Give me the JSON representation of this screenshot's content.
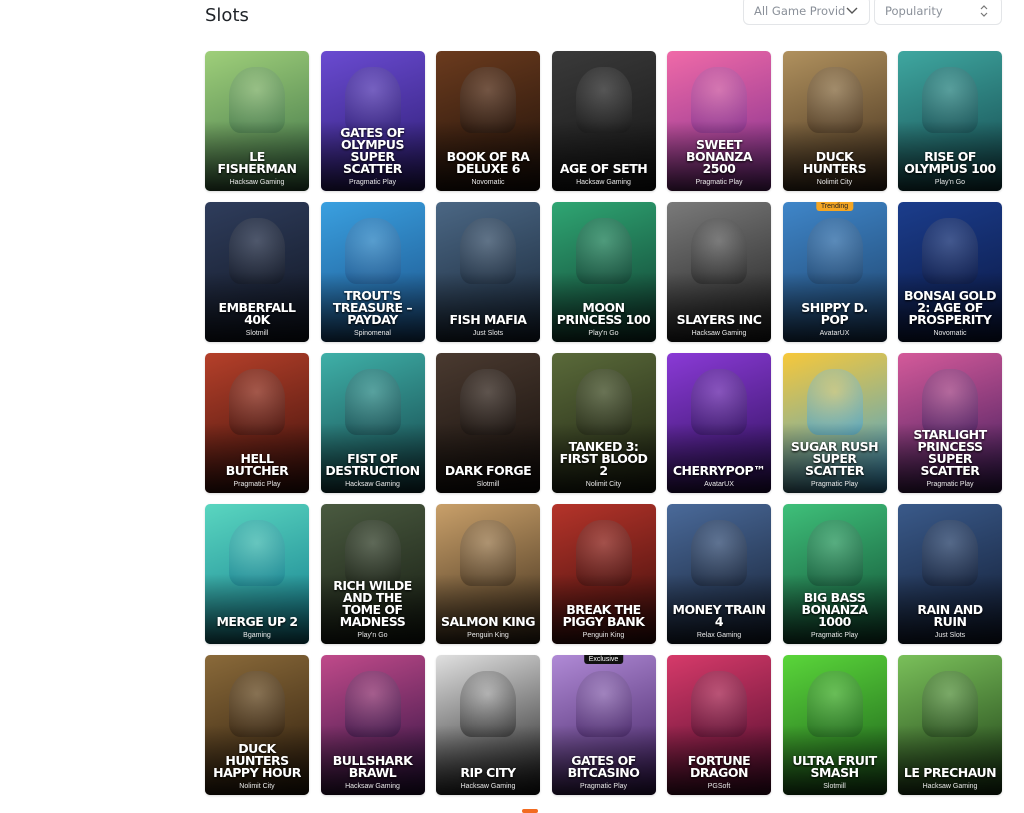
{
  "page": {
    "title": "Slots"
  },
  "filters": {
    "provider": {
      "value": "All Game Provid...",
      "icon": "chevron-down-icon"
    },
    "sort": {
      "value": "Popularity",
      "icon": "sort-updown-icon"
    }
  },
  "games": [
    {
      "title": "LE FISHERMAN",
      "provider": "Hacksaw Gaming",
      "c1": "#9fcf7a",
      "c2": "#3b6f45"
    },
    {
      "title": "GATES OF OLYMPUS SUPER SCATTER",
      "provider": "Pragmatic Play",
      "c1": "#6a4bd1",
      "c2": "#2a1a6e"
    },
    {
      "title": "BOOK OF RA DELUXE 6",
      "provider": "Novomatic",
      "c1": "#6b3b1e",
      "c2": "#1c0f08"
    },
    {
      "title": "AGE OF SETH",
      "provider": "Hacksaw Gaming",
      "c1": "#3a3a3a",
      "c2": "#141414"
    },
    {
      "title": "SWEET BONANZA 2500",
      "provider": "Pragmatic Play",
      "c1": "#f06aa8",
      "c2": "#7b2c8c"
    },
    {
      "title": "DUCK HUNTERS",
      "provider": "Nolimit City",
      "c1": "#b0915e",
      "c2": "#3f2c1a"
    },
    {
      "title": "RISE OF OLYMPUS 100",
      "provider": "Play'n Go",
      "c1": "#3fa7a0",
      "c2": "#12444a"
    },
    {
      "title": "EMBERFALL 40K",
      "provider": "Slotmill",
      "c1": "#2f3d5c",
      "c2": "#0f1420"
    },
    {
      "title": "TROUT'S TREASURE – PAYDAY",
      "provider": "Spinomenal",
      "c1": "#3aa0e0",
      "c2": "#1a4f86"
    },
    {
      "title": "FISH MAFIA",
      "provider": "Just Slots",
      "c1": "#4b6784",
      "c2": "#172536"
    },
    {
      "title": "MOON PRINCESS 100",
      "provider": "Play'n Go",
      "c1": "#2fa673",
      "c2": "#0f3a2e"
    },
    {
      "title": "SLAYERS INC",
      "provider": "Hacksaw Gaming",
      "c1": "#7a7a7a",
      "c2": "#1e1e1e"
    },
    {
      "title": "SHIPPY D. POP",
      "provider": "AvatarUX",
      "c1": "#3f86c9",
      "c2": "#1c3f66",
      "badge": "Trending",
      "badgeType": "trending"
    },
    {
      "title": "BONSAI GOLD 2: AGE OF PROSPERITY",
      "provider": "Novomatic",
      "c1": "#1b3d8c",
      "c2": "#0a1640"
    },
    {
      "title": "HELL BUTCHER",
      "provider": "Pragmatic Play",
      "c1": "#b5402a",
      "c2": "#3a0f0a"
    },
    {
      "title": "FIST OF DESTRUCTION",
      "provider": "Hacksaw Gaming",
      "c1": "#3fb0a8",
      "c2": "#123f45"
    },
    {
      "title": "DARK FORGE",
      "provider": "Slotmill",
      "c1": "#4a3a30",
      "c2": "#120c09"
    },
    {
      "title": "TANKED 3: FIRST BLOOD 2",
      "provider": "Nolimit City",
      "c1": "#5a6a3a",
      "c2": "#1c2010"
    },
    {
      "title": "CHERRYPOP™",
      "provider": "AvatarUX",
      "c1": "#8a3ad6",
      "c2": "#2a0f55"
    },
    {
      "title": "SUGAR RUSH SUPER SCATTER",
      "provider": "Pragmatic Play",
      "c1": "#f7c83a",
      "c2": "#3aa0d8"
    },
    {
      "title": "STARLIGHT PRINCESS SUPER SCATTER",
      "provider": "Pragmatic Play",
      "c1": "#d45a9a",
      "c2": "#3a1a5a"
    },
    {
      "title": "MERGE UP 2",
      "provider": "Bgaming",
      "c1": "#5ad6c0",
      "c2": "#117a8c"
    },
    {
      "title": "RICH WILDE AND THE TOME OF MADNESS",
      "provider": "Play'n Go",
      "c1": "#4a5a40",
      "c2": "#141a10"
    },
    {
      "title": "SALMON KING",
      "provider": "Penguin King",
      "c1": "#c9a06a",
      "c2": "#3a2a18"
    },
    {
      "title": "BREAK THE PIGGY BANK",
      "provider": "Penguin King",
      "c1": "#b5342a",
      "c2": "#3a0c0a"
    },
    {
      "title": "MONEY TRAIN 4",
      "provider": "Relax Gaming",
      "c1": "#4a6a9a",
      "c2": "#141e30"
    },
    {
      "title": "BIG BASS BONANZA 1000",
      "provider": "Pragmatic Play",
      "c1": "#3fc07a",
      "c2": "#0f4a30"
    },
    {
      "title": "RAIN AND RUIN",
      "provider": "Just Slots",
      "c1": "#3a5a8a",
      "c2": "#101a30"
    },
    {
      "title": "DUCK HUNTERS HAPPY HOUR",
      "provider": "Nolimit City",
      "c1": "#8a6a3a",
      "c2": "#2a1a0a"
    },
    {
      "title": "BULLSHARK BRAWL",
      "provider": "Hacksaw Gaming",
      "c1": "#c04a8a",
      "c2": "#2a1040"
    },
    {
      "title": "RIP CITY",
      "provider": "Hacksaw Gaming",
      "c1": "#e0e0e0",
      "c2": "#1a1a1a"
    },
    {
      "title": "GATES OF BITCASINO",
      "provider": "Pragmatic Play",
      "c1": "#b08ad6",
      "c2": "#3a1a5a",
      "badge": "Exclusive",
      "badgeType": "exclusive"
    },
    {
      "title": "FORTUNE DRAGON",
      "provider": "PGSoft",
      "c1": "#d63a6a",
      "c2": "#4a0a2a"
    },
    {
      "title": "ULTRA FRUIT SMASH",
      "provider": "Slotmill",
      "c1": "#5ad63a",
      "c2": "#1a5a1a"
    },
    {
      "title": "LE PRECHAUN",
      "provider": "Hacksaw Gaming",
      "c1": "#7ac05a",
      "c2": "#1a3a14"
    }
  ]
}
